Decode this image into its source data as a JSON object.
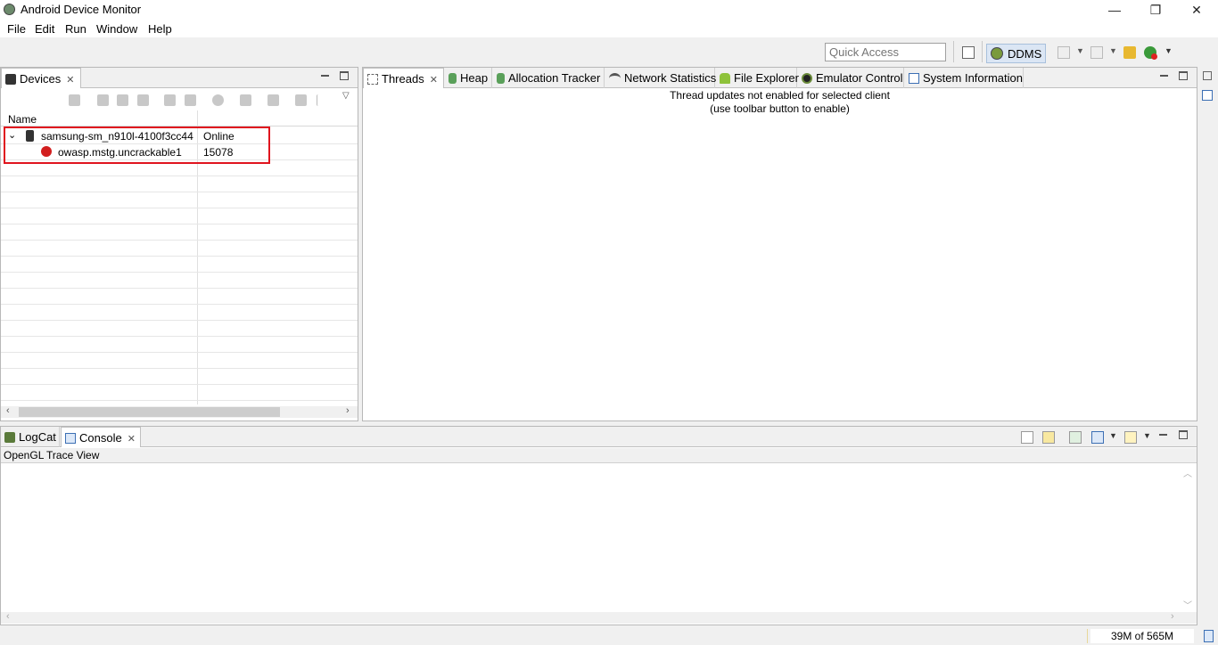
{
  "window": {
    "title": "Android Device Monitor",
    "minimize": "—",
    "restore": "❐",
    "close": "✕"
  },
  "menu": [
    "File",
    "Edit",
    "Run",
    "Window",
    "Help"
  ],
  "toolbar": {
    "quick_access_placeholder": "Quick Access",
    "perspective_label": "DDMS"
  },
  "devices_view": {
    "tab_label": "Devices",
    "column_name": "Name",
    "device": {
      "name": "samsung-sm_n910l-4100f3cc44",
      "status": "Online"
    },
    "client": {
      "name": "owasp.mstg.uncrackable1",
      "pid": "15078"
    }
  },
  "right_tabs": [
    {
      "label": "Threads",
      "icon": "threads-icon",
      "active": true
    },
    {
      "label": "Heap",
      "icon": "heap-icon"
    },
    {
      "label": "Allocation Tracker",
      "icon": "allocation-icon"
    },
    {
      "label": "Network Statistics",
      "icon": "wifi-icon"
    },
    {
      "label": "File Explorer",
      "icon": "android-icon"
    },
    {
      "label": "Emulator Control",
      "icon": "emulator-icon"
    },
    {
      "label": "System Information",
      "icon": "system-info-icon"
    }
  ],
  "threads_message": {
    "line1": "Thread updates not enabled for selected client",
    "line2": "(use toolbar button to enable)"
  },
  "bottom": {
    "tabs": [
      {
        "label": "LogCat",
        "icon": "logcat-icon"
      },
      {
        "label": "Console",
        "icon": "console-icon",
        "active": true
      }
    ],
    "console_title": "OpenGL Trace View"
  },
  "status": {
    "memory": "39M of 565M"
  },
  "colors": {
    "highlight_box": "#e0141e",
    "selected_perspective": "#dbe6f4"
  }
}
